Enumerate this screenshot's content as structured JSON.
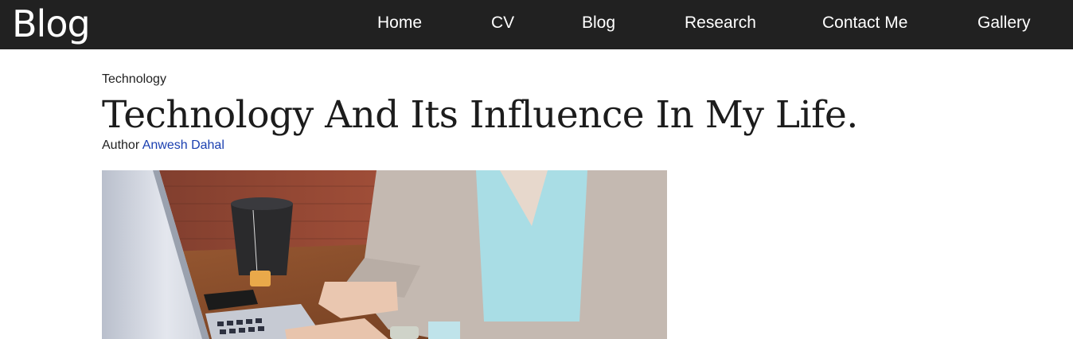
{
  "header": {
    "brand": "Blog",
    "nav": [
      "Home",
      "CV",
      "Blog",
      "Research",
      "Contact Me",
      "Gallery"
    ]
  },
  "post": {
    "category": "Technology",
    "title": "Technology And Its Influence In My Life.",
    "author_label": "Author",
    "author_name": "Anwesh Dahal"
  },
  "colors": {
    "navbar_bg": "#212121",
    "link": "#1a3fb0"
  }
}
